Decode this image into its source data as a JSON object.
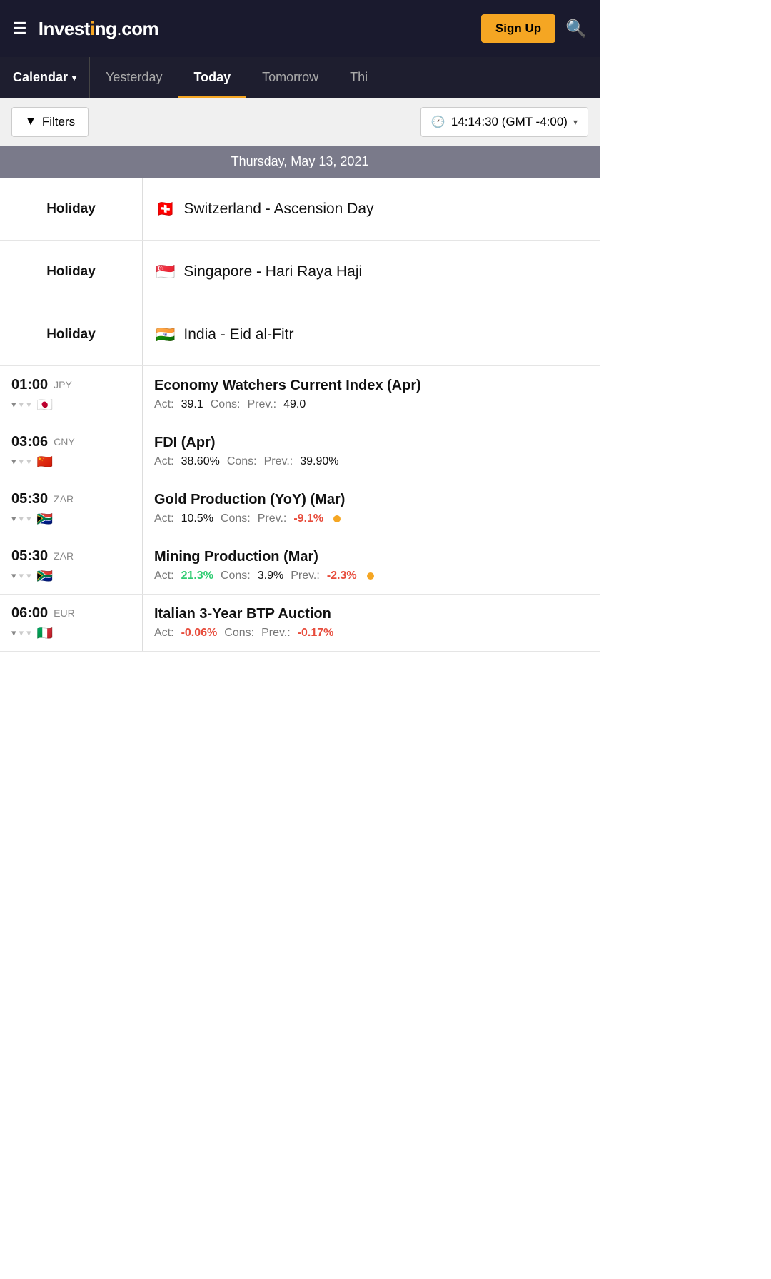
{
  "header": {
    "logo_text": "Investing",
    "logo_dot": ".",
    "logo_com": "com",
    "sign_up_label": "Sign Up"
  },
  "nav": {
    "calendar_label": "Calendar",
    "tabs": [
      {
        "label": "Yesterday",
        "active": false
      },
      {
        "label": "Today",
        "active": true
      },
      {
        "label": "Tomorrow",
        "active": false
      },
      {
        "label": "Thi",
        "active": false
      }
    ]
  },
  "filters": {
    "filters_label": "Filters",
    "time_display": "14:14:30 (GMT -4:00)"
  },
  "date_header": "Thursday, May 13, 2021",
  "events": [
    {
      "type": "holiday",
      "label": "Holiday",
      "flag": "🇨🇭",
      "name": "Switzerland - Ascension Day"
    },
    {
      "type": "holiday",
      "label": "Holiday",
      "flag": "🇸🇬",
      "name": "Singapore - Hari Raya Haji"
    },
    {
      "type": "holiday",
      "label": "Holiday",
      "flag": "🇮🇳",
      "name": "India - Eid al-Fitr"
    },
    {
      "type": "economic",
      "time": "01:00",
      "currency": "JPY",
      "flag": "🇯🇵",
      "bulls": [
        1,
        0,
        0
      ],
      "title": "Economy Watchers Current Index (Apr)",
      "act_label": "Act:",
      "act_value": "39.1",
      "act_color": "normal",
      "cons_label": "Cons:",
      "cons_value": "",
      "prev_label": "Prev.:",
      "prev_value": "49.0",
      "prev_color": "normal",
      "dot": false
    },
    {
      "type": "economic",
      "time": "03:06",
      "currency": "CNY",
      "flag": "🇨🇳",
      "bulls": [
        1,
        0,
        0
      ],
      "title": "FDI (Apr)",
      "act_label": "Act:",
      "act_value": "38.60%",
      "act_color": "normal",
      "cons_label": "Cons:",
      "cons_value": "",
      "prev_label": "Prev.:",
      "prev_value": "39.90%",
      "prev_color": "normal",
      "dot": false
    },
    {
      "type": "economic",
      "time": "05:30",
      "currency": "ZAR",
      "flag": "🇿🇦",
      "bulls": [
        1,
        0,
        0
      ],
      "title": "Gold Production (YoY) (Mar)",
      "act_label": "Act:",
      "act_value": "10.5%",
      "act_color": "normal",
      "cons_label": "Cons:",
      "cons_value": "",
      "prev_label": "Prev.:",
      "prev_value": "-9.1%",
      "prev_color": "red",
      "dot": true
    },
    {
      "type": "economic",
      "time": "05:30",
      "currency": "ZAR",
      "flag": "🇿🇦",
      "bulls": [
        1,
        0,
        0
      ],
      "title": "Mining Production (Mar)",
      "act_label": "Act:",
      "act_value": "21.3%",
      "act_color": "green",
      "cons_label": "Cons:",
      "cons_value": "3.9%",
      "prev_label": "Prev.:",
      "prev_value": "-2.3%",
      "prev_color": "red",
      "dot": true
    },
    {
      "type": "economic",
      "time": "06:00",
      "currency": "EUR",
      "flag": "🇮🇹",
      "bulls": [
        1,
        0,
        0
      ],
      "title": "Italian 3-Year BTP Auction",
      "act_label": "Act:",
      "act_value": "-0.06%",
      "act_color": "red",
      "cons_label": "Cons:",
      "cons_value": "",
      "prev_label": "Prev.:",
      "prev_value": "-0.17%",
      "prev_color": "red",
      "dot": false
    }
  ]
}
